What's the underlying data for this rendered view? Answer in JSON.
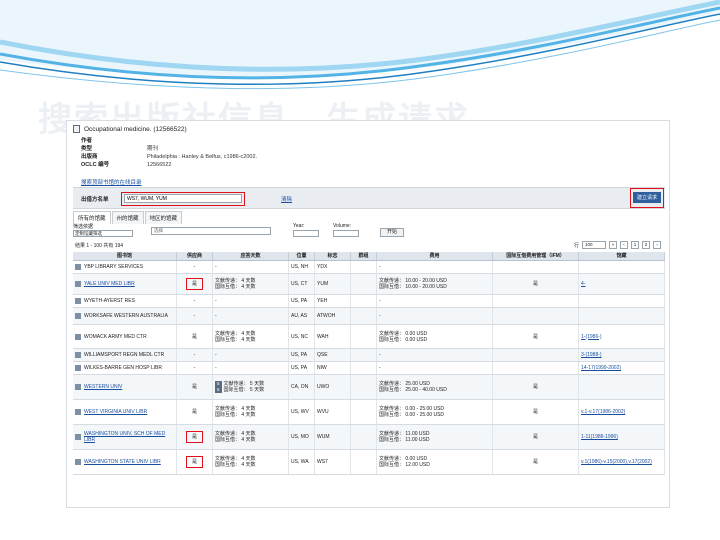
{
  "slide": {
    "title": "搜索出版社信息，生成请求",
    "bg_color": "#ffffff",
    "wave_colors": [
      "#1f7fc2",
      "#53b2e6",
      "#9fd6f2"
    ]
  },
  "record": {
    "title": "Occupational medicine. (12566522)",
    "meta": [
      {
        "label": "作者",
        "value": ""
      },
      {
        "label": "类型",
        "value": "期刊"
      },
      {
        "label": "出版商",
        "value": "Philadelphia : Hanley & Belfus, c1986-c2002."
      },
      {
        "label": "OCLC 编号",
        "value": "12566522"
      }
    ],
    "find_link": "搜索顶部书馆的在线目录"
  },
  "supplier": {
    "label": "出借方名单",
    "value": "WS7, WUM, YUM",
    "clear": "清除",
    "create_button": "建立请求"
  },
  "tabs": [
    "所有的馆藏",
    "州的馆藏",
    "地区的馆藏"
  ],
  "filters": {
    "label": "筛选依据",
    "select_value": "定制馆藏筛选",
    "select2_value": "选择",
    "year_label": "Year:",
    "volume_label": "Volume:",
    "go_label": "开始"
  },
  "results": {
    "count_text": "结果 1 - 100 共有 194",
    "page_label": "行",
    "per_page": "100",
    "page_current": "1",
    "page_next": "2"
  },
  "columns": [
    "图书馆",
    "供应商",
    "应答天数",
    "位置",
    "标志",
    "群组",
    "费用",
    "国际互借费用管理（IFM）",
    "馆藏"
  ],
  "rows": [
    {
      "library": "YBP LIBRARY SERVICES",
      "link": false,
      "supplier": "-",
      "loan": [
        "-"
      ],
      "location": "US, NH",
      "symbol": "YDX",
      "group": "",
      "fee": [
        "-"
      ],
      "ifm": "",
      "holdings": ""
    },
    {
      "library": "YALE UNIV MED LIBR",
      "link": true,
      "supplier": "是",
      "supplier_mark": true,
      "loan": [
        "文献传递：  4 天数",
        "国际互借：  4 天数"
      ],
      "location": "US, CT",
      "symbol": "YUM",
      "group": "",
      "fee": [
        "文献传递：  10.00 - 20.00 USD",
        "国际互借：  10.00 - 20.00 USD"
      ],
      "ifm": "是",
      "holdings": "4-"
    },
    {
      "library": "WYETH-AYERST RES",
      "link": false,
      "supplier": "-",
      "loan": [
        "-"
      ],
      "location": "US, PA",
      "symbol": "YEH",
      "group": "",
      "fee": [
        "-"
      ],
      "ifm": "",
      "holdings": ""
    },
    {
      "library": "WORKSAFE WESTERN AUSTRALIA",
      "link": false,
      "supplier": "-",
      "loan": [
        "-"
      ],
      "location": "AU, AS",
      "symbol": "ATWOH",
      "group": "",
      "fee": [
        "-"
      ],
      "ifm": "",
      "holdings": ""
    },
    {
      "library": "WOMACK ARMY MED CTR",
      "link": false,
      "supplier": "是",
      "loan": [
        "文献传递：  4 天数",
        "国际互借：  4 天数"
      ],
      "location": "US, NC",
      "symbol": "WAH",
      "group": "",
      "fee": [
        "文献传递：  0.00 USD",
        "国际互借：  0.00 USD"
      ],
      "ifm": "是",
      "holdings": "1-(1986-)"
    },
    {
      "library": "WILLIAMSPORT REGN MEDL CTR",
      "link": false,
      "supplier": "-",
      "loan": [
        "-"
      ],
      "location": "US, PA",
      "symbol": "QSE",
      "group": "",
      "fee": [
        "-"
      ],
      "ifm": "",
      "holdings": "3-(1988-)"
    },
    {
      "library": "WILKES-BARRE GEN HOSP LIBR",
      "link": false,
      "supplier": "-",
      "loan": [
        "-"
      ],
      "location": "US, PA",
      "symbol": "NIW",
      "group": "",
      "fee": [
        "-"
      ],
      "ifm": "",
      "holdings": "14-17(1999-2002)"
    },
    {
      "library": "WESTERN UNIV",
      "link": true,
      "supplier": "是",
      "loan": [
        "文献传递：  5 天数",
        "国际互借：  5 天数"
      ],
      "badges": true,
      "location": "CA, ON",
      "symbol": "UWO",
      "group": "",
      "fee": [
        "文献传递：  25.00 USD",
        "国际互借：  25.00 - 40.00 USD"
      ],
      "ifm": "是",
      "holdings": ""
    },
    {
      "library": "WEST VIRGINIA UNIV LIBR",
      "link": true,
      "supplier": "是",
      "loan": [
        "文献传递：  4 天数",
        "国际互借：  4 天数"
      ],
      "location": "US, WV",
      "symbol": "WVU",
      "group": "",
      "fee": [
        "文献传递：  0.00 - 25.00 USD",
        "国际互借：  0.00 - 25.00 USD"
      ],
      "ifm": "是",
      "holdings": "v.1-v.17(1986-2002)"
    },
    {
      "library": "WASHINGTON UNIV, SCH OF MED LIBR",
      "link": true,
      "supplier": "是",
      "supplier_mark": true,
      "loan": [
        "文献传递：  4 天数",
        "国际互借：  4 天数"
      ],
      "location": "US, MO",
      "symbol": "WUM",
      "group": "",
      "fee": [
        "文献传递：  11.00 USD",
        "国际互借：  11.00 USD"
      ],
      "ifm": "是",
      "holdings": "1-11(1986-1996)"
    },
    {
      "library": "WASHINGTON STATE UNIV LIBR",
      "link": true,
      "supplier": "是",
      "supplier_mark": true,
      "loan": [
        "文献传递：  4 天数",
        "国际互借：  4 天数"
      ],
      "location": "US, WA",
      "symbol": "WS7",
      "group": "",
      "fee": [
        "文献传递：  0.00 USD",
        "国际互借：  12.00 USD"
      ],
      "ifm": "是",
      "holdings": "v.1(1986)-v.15(2000),v.17(2002)"
    }
  ]
}
